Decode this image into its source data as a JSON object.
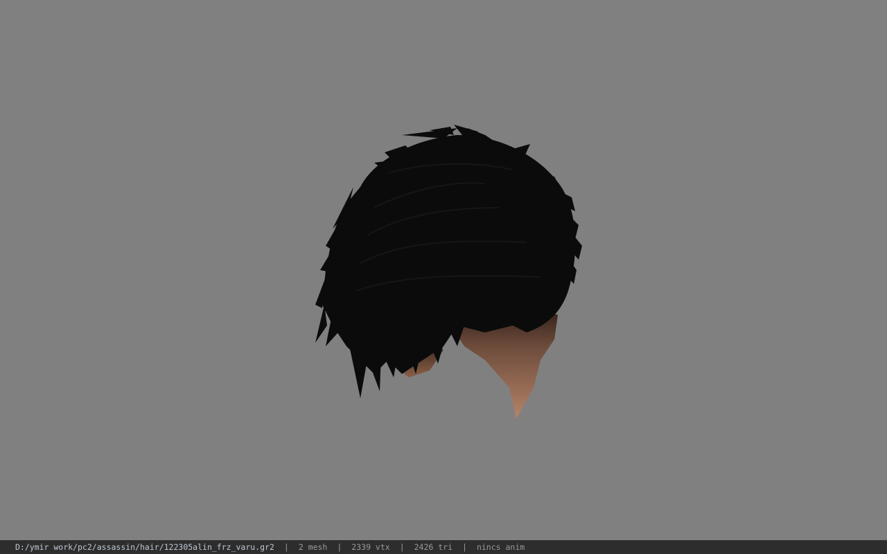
{
  "viewer": {
    "background_color": "#808080",
    "model_subject": "black-hair-mesh",
    "hair_color": "#0c0c0c",
    "skin_color": "#a87a60"
  },
  "status_bar": {
    "file_path": "D:/ymir work/pc2/assassin/hair/122305alin_frz_varu.gr2",
    "mesh_count": "2 mesh",
    "vertex_count": "2339 vtx",
    "triangle_count": "2426 tri",
    "anim_status": "nincs anim",
    "separator": "|"
  }
}
